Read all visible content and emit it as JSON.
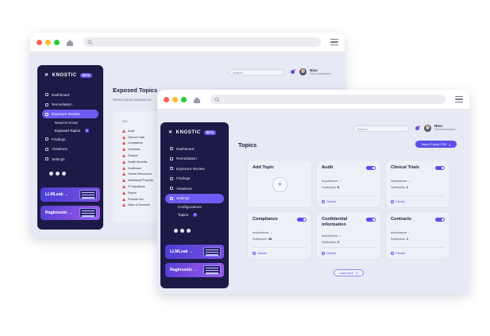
{
  "back_window": {
    "brand": "KNOSTIC",
    "beta": "BETA",
    "nav": [
      {
        "label": "Dashboard",
        "icon": "dashboard-icon"
      },
      {
        "label": "Remediation",
        "icon": "shield-icon"
      },
      {
        "label": "Exposure Review",
        "icon": "review-icon",
        "active": true
      },
      {
        "label": "Findings",
        "icon": "search-icon"
      },
      {
        "label": "Violations",
        "icon": "warning-icon"
      },
      {
        "label": "Settings",
        "icon": "gear-icon"
      }
    ],
    "subnav": [
      {
        "label": "Need to Know"
      },
      {
        "label": "Exposed Topics",
        "badge": "8"
      }
    ],
    "promo_llmleak": "LLMLeak",
    "promo_ragknostic": "Ragknostic",
    "page_title": "Exposed Topics",
    "page_subtitle": "Review topics assigned to",
    "search_placeholder": "Search",
    "user_name": "Nico",
    "user_desc": "Client Description",
    "table_header": "Dev",
    "topics": [
      "Audit",
      "Clinical Trials",
      "Compliance",
      "Contracts",
      "Finance",
      "Health Benefits",
      "Healthcare",
      "Human Resources",
      "Intellectual Property",
      "IT Operations",
      "Payroll",
      "Product Dev",
      "Sales & Revenue"
    ]
  },
  "front_window": {
    "brand": "KNOSTIC",
    "beta": "BETA",
    "nav": [
      {
        "label": "Dashboard",
        "icon": "dashboard-icon"
      },
      {
        "label": "Remediation",
        "icon": "shield-icon"
      },
      {
        "label": "Exposure Review",
        "icon": "review-icon"
      },
      {
        "label": "Findings",
        "icon": "search-icon"
      },
      {
        "label": "Violations",
        "icon": "warning-icon"
      },
      {
        "label": "Settings",
        "icon": "gear-icon",
        "active": true
      }
    ],
    "subnav": [
      {
        "label": "Configurations"
      },
      {
        "label": "Topics",
        "badge": "8"
      }
    ],
    "promo_llmleak": "LLMLeak",
    "promo_ragknostic": "Ragknostic",
    "page_title": "Topics",
    "import_button": "Import Topics CSV",
    "search_placeholder": "Search",
    "user_name": "Nico",
    "user_desc": "Client Description",
    "add_topic": "Add Topic",
    "importance_label": "Importance:",
    "subtopics_label": "Subtopics:",
    "details_label": "Details",
    "load_more": "Load more",
    "cards": [
      {
        "title": "Audit",
        "importance": "–",
        "subtopics": "8"
      },
      {
        "title": "Clinical Trials",
        "importance": "–",
        "subtopics": "1"
      },
      {
        "title": "Compliance",
        "importance": "–",
        "subtopics": "28"
      },
      {
        "title": "Confidential information",
        "importance": "–",
        "subtopics": "2"
      },
      {
        "title": "Contracts",
        "importance": "–",
        "subtopics": "1"
      }
    ]
  }
}
